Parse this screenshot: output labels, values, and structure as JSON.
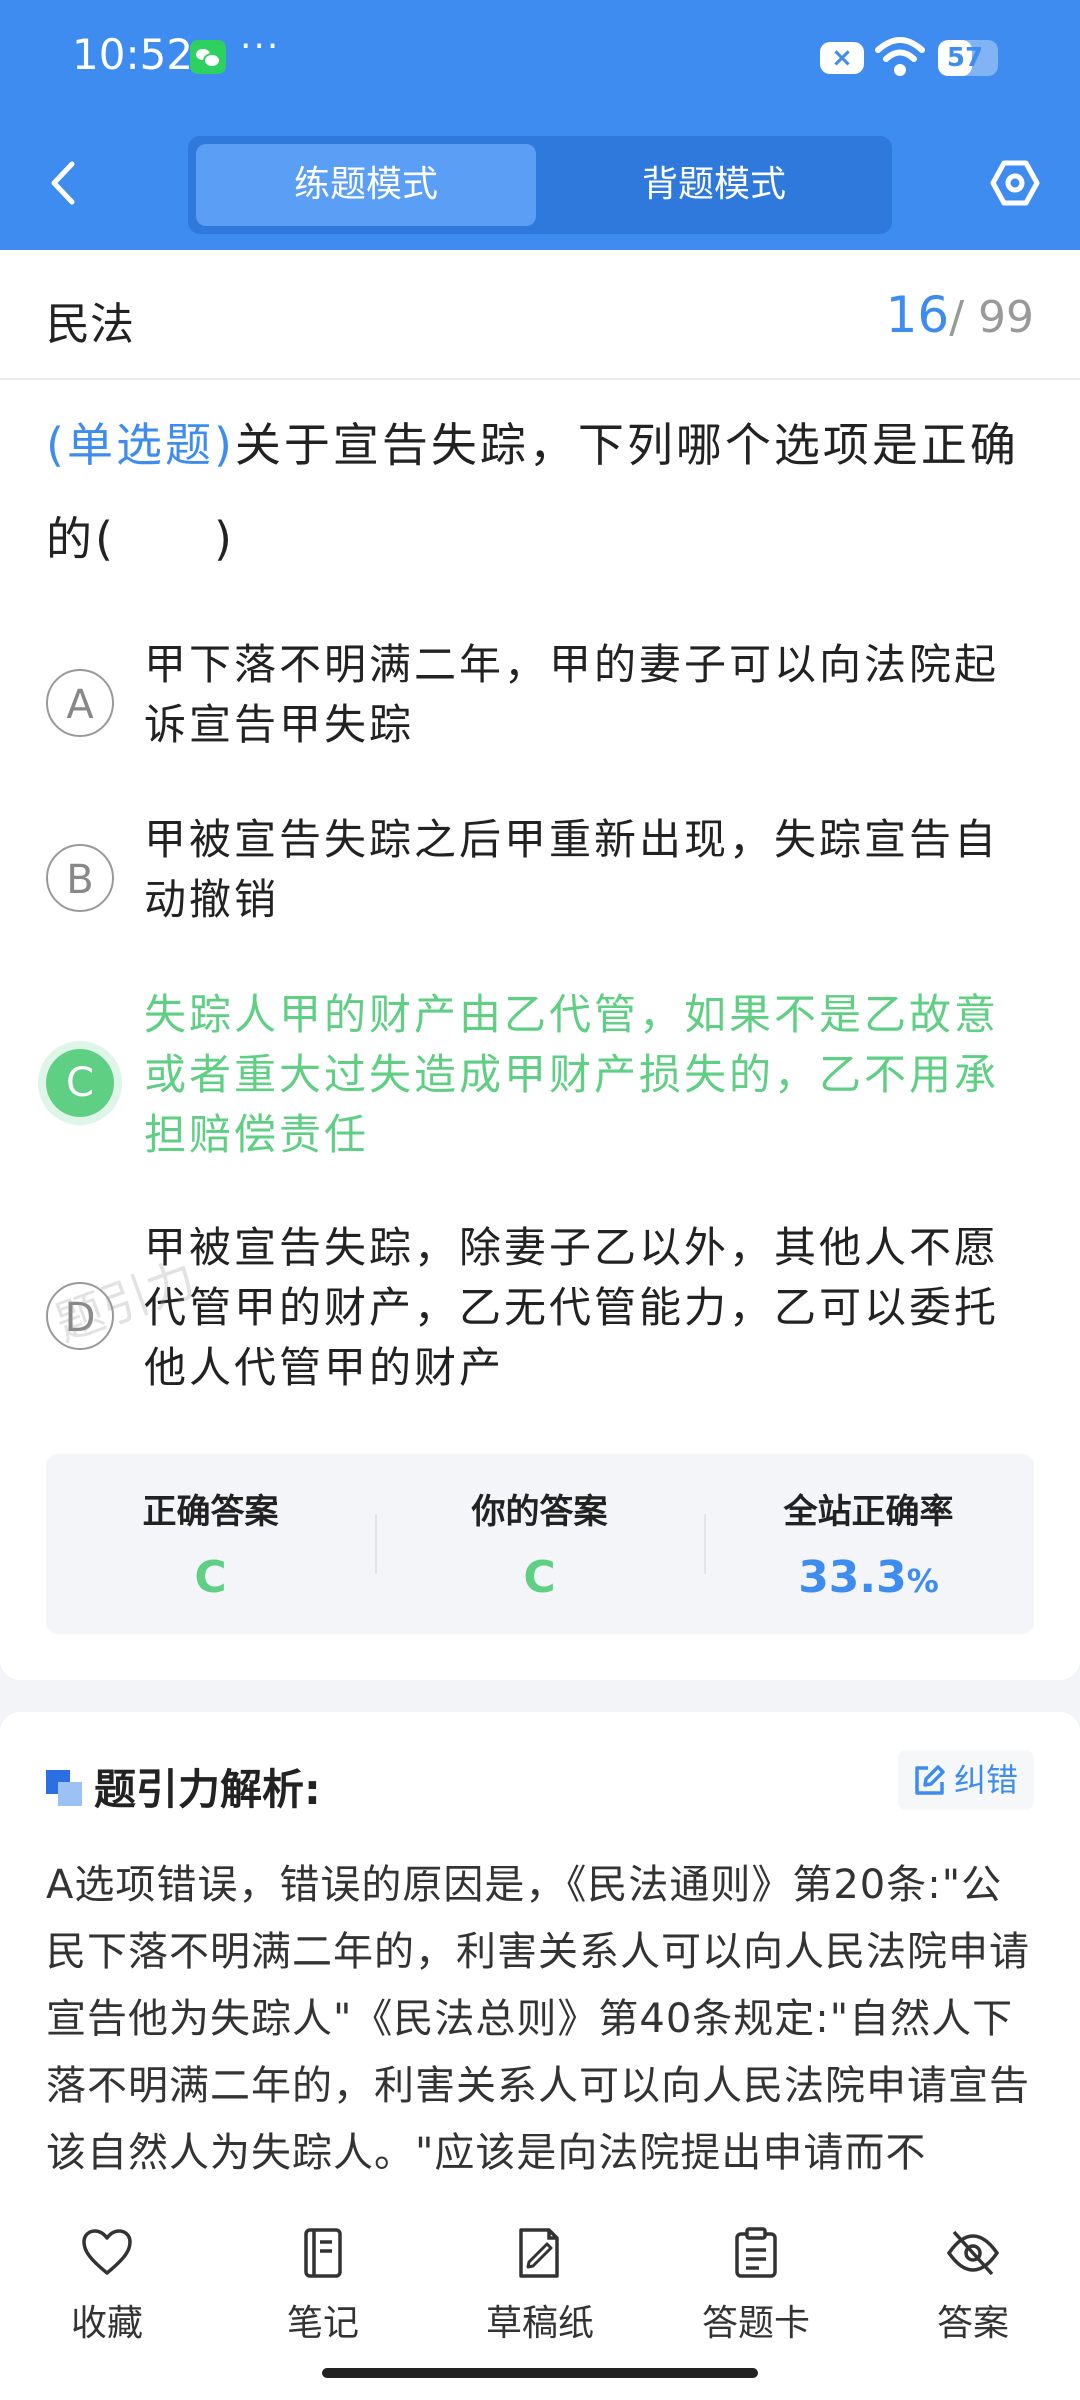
{
  "status_bar": {
    "time": "10:52",
    "more": "···",
    "sim_badge": "×",
    "battery": "57",
    "battery_level": 0.57
  },
  "header": {
    "back_icon": "chevron-left-icon",
    "tabs": [
      {
        "label": "练题模式",
        "active": true
      },
      {
        "label": "背题模式",
        "active": false
      }
    ],
    "settings_icon": "hexagon-settings-icon",
    "colors": {
      "background": "#3f8cf0",
      "active_tab": "#5a9ff5"
    }
  },
  "question_card": {
    "subject": "民法",
    "progress_current": "16",
    "progress_total": "/ 99",
    "question_type": "(单选题)",
    "question_text": "关于宣告失踪，下列哪个选项是正确的(　　)",
    "options": [
      {
        "letter": "A",
        "text": "甲下落不明满二年，甲的妻子可以向法院起诉宣告甲失踪",
        "correct": false
      },
      {
        "letter": "B",
        "text": "甲被宣告失踪之后甲重新出现，失踪宣告自动撤销",
        "correct": false
      },
      {
        "letter": "C",
        "text": "失踪人甲的财产由乙代管，如果不是乙故意或者重大过失造成甲财产损失的，乙不用承担赔偿责任",
        "correct": true
      },
      {
        "letter": "D",
        "text": "甲被宣告失踪，除妻子乙以外，其他人不愿代管甲的财产，乙无代管能力，乙可以委托他人代管甲的财产",
        "correct": false
      }
    ],
    "watermark": "题引力",
    "stats": {
      "correct_answer_label": "正确答案",
      "correct_answer": "C",
      "your_answer_label": "你的答案",
      "your_answer": "C",
      "accuracy_label": "全站正确率",
      "accuracy_value": "33.3",
      "accuracy_unit": "%"
    },
    "colors": {
      "correct": "#5fcf83",
      "accent": "#3f8cf0"
    }
  },
  "analysis": {
    "title": "题引力解析:",
    "report_button": "纠错",
    "text": "A选项错误，错误的原因是，《民法通则》第20条:\"公民下落不明满二年的，利害关系人可以向人民法院申请宣告他为失踪人\"《民法总则》第40条规定:\"自然人下落不明满二年的，利害关系人可以向人民法院申请宣告该自然人为失踪人。\"应该是向法院提出申请而不"
  },
  "toolbar": {
    "items": [
      {
        "label": "收藏",
        "icon": "heart-icon"
      },
      {
        "label": "笔记",
        "icon": "notebook-icon"
      },
      {
        "label": "草稿纸",
        "icon": "draft-paper-icon"
      },
      {
        "label": "答题卡",
        "icon": "answer-sheet-icon"
      },
      {
        "label": "答案",
        "icon": "eye-off-icon"
      }
    ]
  }
}
